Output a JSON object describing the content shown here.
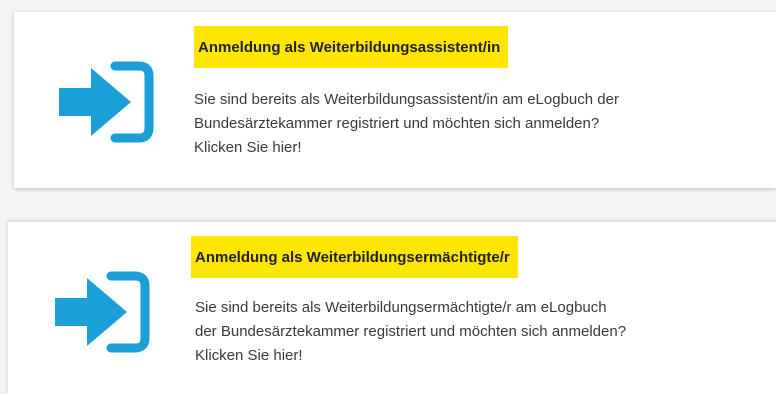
{
  "colors": {
    "icon_blue": "#1a9fd9",
    "title_highlight": "#ffe600",
    "card_background": "#ffffff"
  },
  "cards": [
    {
      "icon": "login-arrow-icon",
      "title": "Anmeldung als Weiterbildungsassistent/in",
      "text_lines": [
        "Sie sind bereits als Weiterbildungsassistent/in am eLogbuch der",
        "Bundesärztekammer registriert und möchten sich anmelden?",
        "Klicken Sie hier!"
      ]
    },
    {
      "icon": "login-arrow-icon",
      "title": "Anmeldung als Weiterbildungsermächtigte/r",
      "text_lines": [
        "Sie sind bereits als Weiterbildungsermächtigte/r am eLogbuch",
        "der Bundesärztekammer registriert und möchten sich anmelden?",
        "Klicken Sie hier!"
      ]
    }
  ]
}
